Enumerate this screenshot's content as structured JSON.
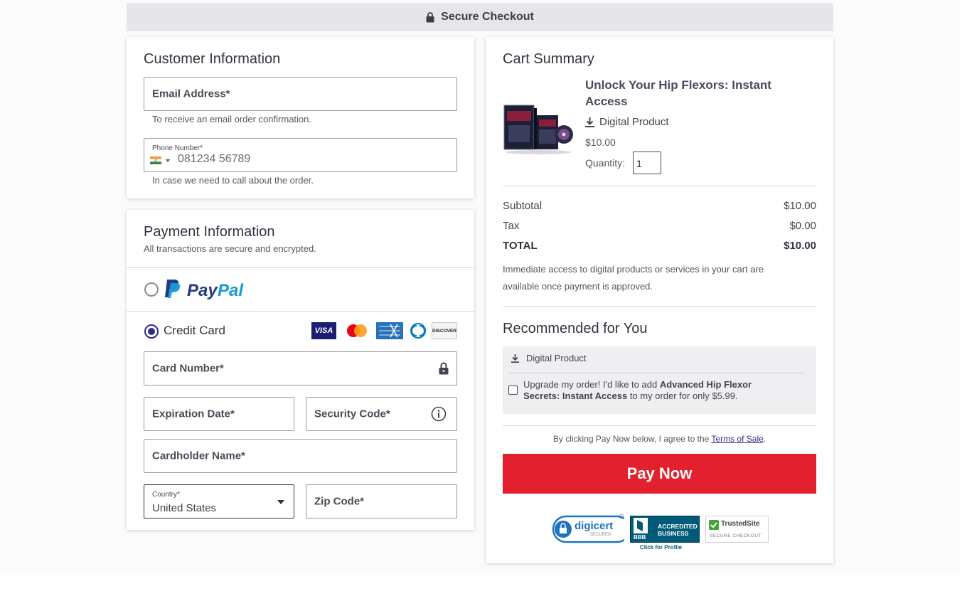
{
  "header": {
    "title": "Secure Checkout"
  },
  "customer": {
    "title": "Customer Information",
    "email_label": "Email Address*",
    "email_help": "To receive an email order confirmation.",
    "phone_label": "Phone Number*",
    "phone_placeholder": "081234 56789",
    "phone_help": "In case we need to call about the order."
  },
  "payment": {
    "title": "Payment Information",
    "subtitle": "All transactions are secure and encrypted.",
    "paypal_pay": "Pay",
    "paypal_pal": "Pal",
    "credit_card_label": "Credit Card",
    "card_brands": [
      "VISA",
      "DISCOVER"
    ],
    "card_number_label": "Card Number*",
    "expiration_label": "Expiration Date*",
    "security_label": "Security Code*",
    "cardholder_label": "Cardholder Name*",
    "country_label": "Country*",
    "country_value": "United States",
    "zip_label": "Zip Code*"
  },
  "cart": {
    "title": "Cart Summary",
    "product_name": "Unlock Your Hip Flexors: Instant Access",
    "product_type": "Digital Product",
    "price": "$10.00",
    "quantity_label": "Quantity:",
    "quantity_value": "1",
    "subtotal_label": "Subtotal",
    "subtotal_value": "$10.00",
    "tax_label": "Tax",
    "tax_value": "$0.00",
    "total_label": "TOTAL",
    "total_value": "$10.00",
    "access_note": "Immediate access to digital products or services in your cart are available once payment is approved."
  },
  "recommend": {
    "title": "Recommended for You",
    "type": "Digital Product",
    "text_pre": "Upgrade my order! I'd like to add ",
    "text_bold": "Advanced Hip Flexor Secrets: Instant Access",
    "text_post": " to my order for only $5.99."
  },
  "terms": {
    "pre": "By clicking Pay Now below, I agree to the ",
    "link": "Terms of Sale",
    "post": "."
  },
  "pay_button": "Pay Now",
  "trust": {
    "digicert": "digicert",
    "digicert_sub": "SECURED",
    "bbb_line1": "ACCREDITED",
    "bbb_line2": "BUSINESS",
    "bbb_mark": "BBB",
    "bbb_profile": "Click for Profile",
    "trustedsite": "TrustedSite",
    "trustedsite_sub": "SECURE CHECKOUT"
  },
  "colors": {
    "pay_button": "#e3202e",
    "radio_selected": "#2f2c8c",
    "paypal_dark": "#253b80",
    "paypal_light": "#179bd7"
  }
}
